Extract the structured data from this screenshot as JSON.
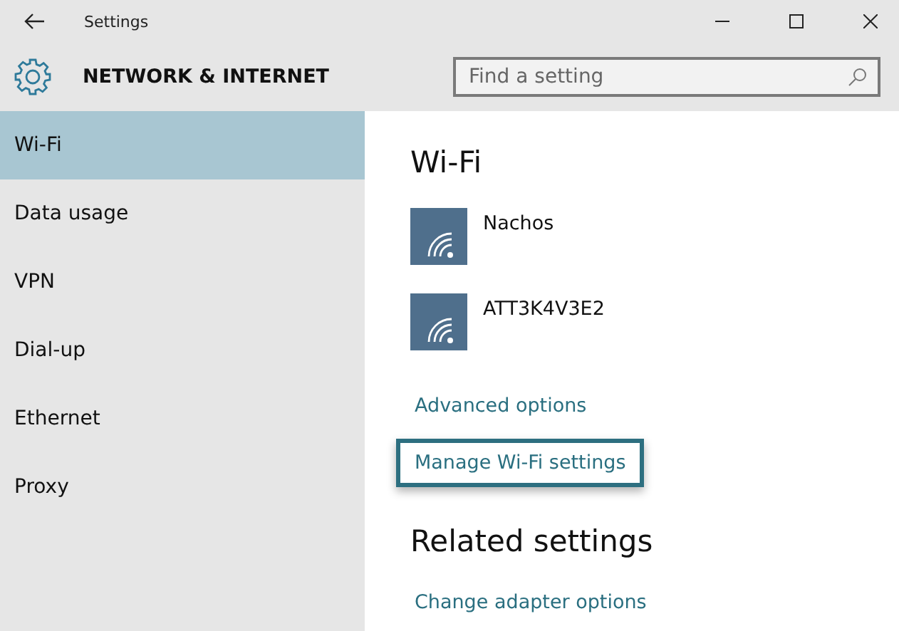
{
  "window": {
    "title": "Settings"
  },
  "header": {
    "title": "NETWORK & INTERNET",
    "search": {
      "placeholder": "Find a setting"
    }
  },
  "sidebar": {
    "items": [
      {
        "label": "Wi-Fi",
        "selected": true
      },
      {
        "label": "Data usage",
        "selected": false
      },
      {
        "label": "VPN",
        "selected": false
      },
      {
        "label": "Dial-up",
        "selected": false
      },
      {
        "label": "Ethernet",
        "selected": false
      },
      {
        "label": "Proxy",
        "selected": false
      }
    ]
  },
  "content": {
    "heading": "Wi-Fi",
    "networks": [
      {
        "name": "Nachos"
      },
      {
        "name": "ATT3K4V3E2"
      }
    ],
    "links": [
      {
        "label": "Advanced options",
        "focused": false
      },
      {
        "label": "Manage Wi-Fi settings",
        "focused": true
      }
    ],
    "related_heading": "Related settings",
    "related_links": [
      {
        "label": "Change adapter options"
      }
    ]
  }
}
